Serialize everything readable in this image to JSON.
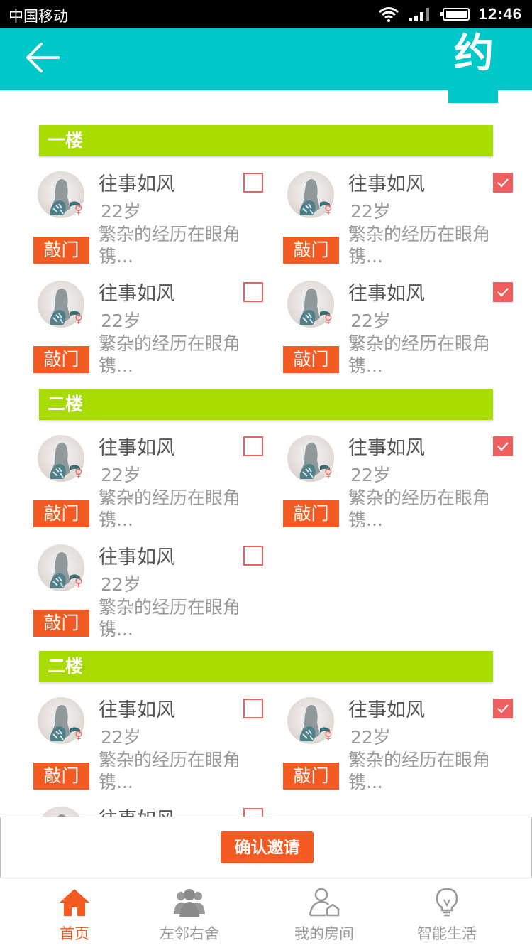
{
  "status_bar": {
    "carrier": "中国移动",
    "time": "12:46"
  },
  "header": {
    "badge": "约"
  },
  "floors": [
    {
      "title": "一楼"
    },
    {
      "title": "二楼"
    },
    {
      "title": "二楼"
    }
  ],
  "person": {
    "name": "往事如风",
    "age": "22岁",
    "desc": "繁杂的经历在眼角镌...",
    "gender_symbol": "♀",
    "knock_label": "敲门"
  },
  "cards": [
    {
      "checked": false
    },
    {
      "checked": true
    },
    {
      "checked": false
    },
    {
      "checked": true
    },
    {
      "checked": false
    },
    {
      "checked": true
    },
    {
      "checked": false
    },
    {
      "checked": false
    },
    {
      "checked": true
    },
    {
      "checked": false
    }
  ],
  "action": {
    "confirm_label": "确认邀请"
  },
  "tabs": [
    {
      "label": "首页",
      "icon": "home-icon",
      "active": true
    },
    {
      "label": "左邻右舍",
      "icon": "neighbors-icon",
      "active": false
    },
    {
      "label": "我的房间",
      "icon": "my-room-icon",
      "active": false
    },
    {
      "label": "智能生活",
      "icon": "lightbulb-icon",
      "active": false
    }
  ],
  "colors": {
    "header": "#00c8c8",
    "floor": "#a8dc00",
    "accent": "#f45b23",
    "checkbox": "#f05f5f"
  }
}
